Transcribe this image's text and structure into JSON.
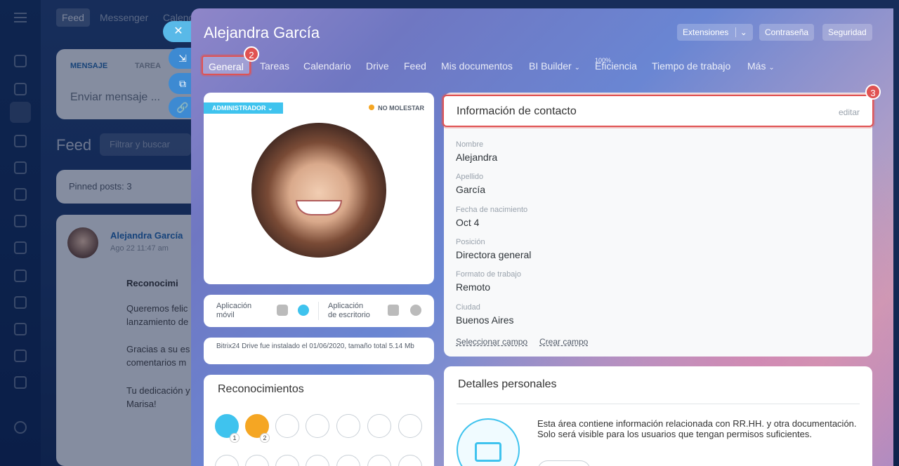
{
  "background": {
    "tabs": [
      "Feed",
      "Messenger",
      "Calend"
    ],
    "composer": {
      "tab1": "MENSAJE",
      "tab2": "TAREA",
      "placeholder": "Enviar mensaje ..."
    },
    "feed_title": "Feed",
    "filter_placeholder": "Filtrar y buscar",
    "pinned": "Pinned posts: 3",
    "post": {
      "author": "Alejandra García",
      "date": "Ago 22 11:47 am",
      "heading": "Reconocimi",
      "line1": "Queremos felic",
      "line2": "lanzamiento de",
      "line3": "Gracias a su es",
      "line4": "comentarios m",
      "line5": "Tu dedicación y",
      "line6": "Marisa!"
    }
  },
  "profile": {
    "name": "Alejandra García",
    "buttons": {
      "extensions": "Extensiones",
      "password": "Contraseña",
      "security": "Seguridad"
    },
    "tabs": [
      "General",
      "Tareas",
      "Calendario",
      "Drive",
      "Feed",
      "Mis documentos",
      "BI Builder",
      "Eficiencia",
      "Tiempo de trabajo",
      "Más"
    ],
    "efficiency_pct": "100%",
    "callouts": {
      "tab": "2",
      "contact": "3"
    },
    "role_badge": "ADMINISTRADOR",
    "status": "NO MOLESTAR",
    "apps": {
      "mobile1": "Aplicación",
      "mobile2": "móvil",
      "desktop1": "Aplicación",
      "desktop2": "de escritorio"
    },
    "drive_note": "Bitrix24 Drive fue instalado el 01/06/2020, tamaño total 5.14 Mb",
    "recognitions": {
      "title": "Reconocimientos",
      "count1": "1",
      "count2": "2"
    },
    "contact": {
      "title": "Información de contacto",
      "edit": "editar",
      "fields": [
        {
          "label": "Nombre",
          "value": "Alejandra"
        },
        {
          "label": "Apellido",
          "value": "García"
        },
        {
          "label": "Fecha de nacimiento",
          "value": "Oct 4"
        },
        {
          "label": "Posición",
          "value": "Directora general"
        },
        {
          "label": "Formato de trabajo",
          "value": "Remoto"
        },
        {
          "label": "Ciudad",
          "value": "Buenos Aires"
        }
      ],
      "select_field": "Seleccionar campo",
      "create_field": "Crear campo"
    },
    "personal": {
      "title": "Detalles personales",
      "text": "Esta área contiene información relacionada con RR.HH. y otra documentación. Solo será visible para los usuarios que tengan permisos suficientes."
    }
  },
  "colors": {
    "accent": "#2fa9e4",
    "callout": "#e05252",
    "status_dot": "#f5a623"
  }
}
